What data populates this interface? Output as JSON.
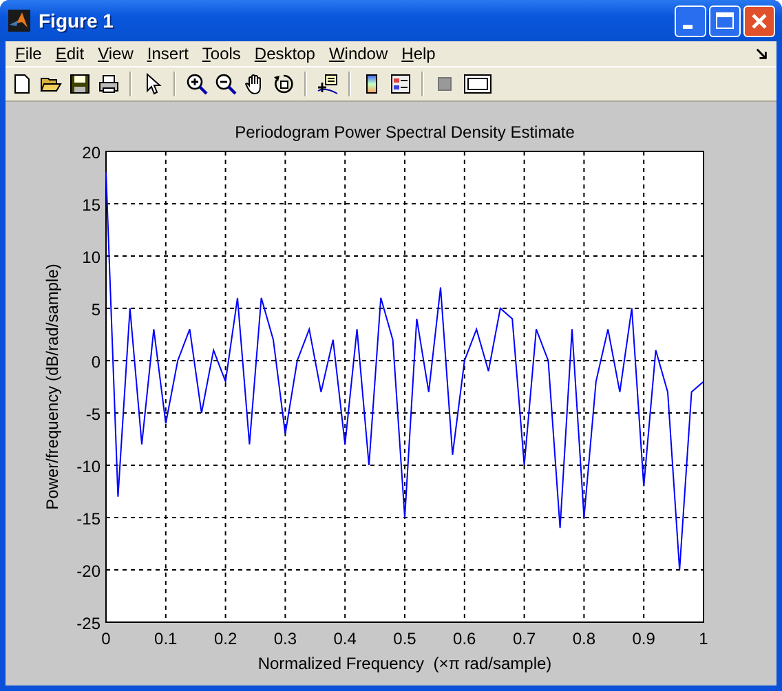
{
  "window": {
    "title": "Figure 1"
  },
  "menu": [
    {
      "label": "File"
    },
    {
      "label": "Edit"
    },
    {
      "label": "View"
    },
    {
      "label": "Insert"
    },
    {
      "label": "Tools"
    },
    {
      "label": "Desktop"
    },
    {
      "label": "Window"
    },
    {
      "label": "Help"
    }
  ],
  "chart_data": {
    "type": "line",
    "grid": true,
    "title": "Periodogram Power Spectral Density Estimate",
    "xlabel": "Normalized Frequency  (×π rad/sample)",
    "ylabel": "Power/frequency (dB/rad/sample)",
    "xlim": [
      0,
      1
    ],
    "ylim": [
      -25,
      20
    ],
    "xticks": [
      0,
      0.1,
      0.2,
      0.3,
      0.4,
      0.5,
      0.6,
      0.7,
      0.8,
      0.9,
      1
    ],
    "yticks": [
      -25,
      -20,
      -15,
      -10,
      -5,
      0,
      5,
      10,
      15,
      20
    ],
    "x": [
      0,
      0.02,
      0.04,
      0.06,
      0.08,
      0.1,
      0.12,
      0.14,
      0.16,
      0.18,
      0.2,
      0.22,
      0.24,
      0.26,
      0.28,
      0.3,
      0.32,
      0.34,
      0.36,
      0.38,
      0.4,
      0.42,
      0.44,
      0.46,
      0.48,
      0.5,
      0.52,
      0.54,
      0.56,
      0.58,
      0.6,
      0.62,
      0.64,
      0.66,
      0.68,
      0.7,
      0.72,
      0.74,
      0.76,
      0.78,
      0.8,
      0.82,
      0.84,
      0.86,
      0.88,
      0.9,
      0.92,
      0.94,
      0.96,
      0.98,
      1
    ],
    "series": [
      {
        "color": "#0000ff",
        "values": [
          18,
          -13,
          5,
          -8,
          3,
          -6,
          0,
          3,
          -5,
          1,
          -2,
          6,
          -8,
          6,
          2,
          -7,
          0,
          3,
          -3,
          2,
          -8,
          3,
          -10,
          6,
          2,
          -15,
          4,
          -3,
          7,
          -9,
          0,
          3,
          -1,
          5,
          4,
          -10,
          3,
          0,
          -16,
          3,
          -15,
          -2,
          3,
          -3,
          5,
          -12,
          1,
          -3,
          -20,
          -3,
          -2
        ]
      }
    ]
  }
}
